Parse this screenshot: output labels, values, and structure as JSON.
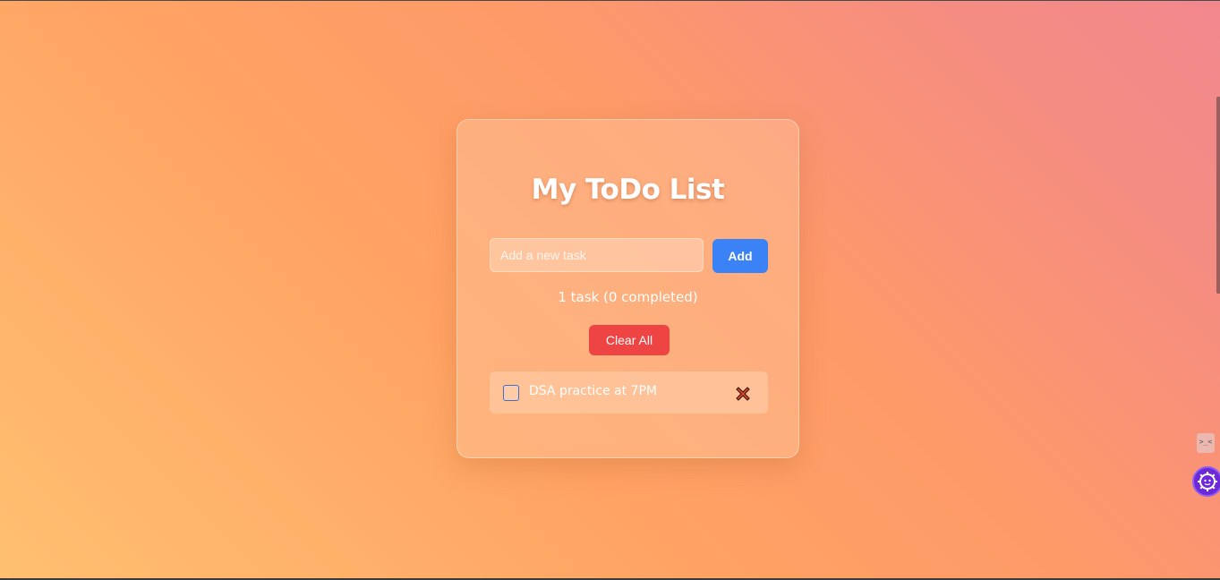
{
  "app": {
    "title": "My ToDo List"
  },
  "input": {
    "placeholder": "Add a new task",
    "value": ""
  },
  "buttons": {
    "add_label": "Add",
    "clear_label": "Clear All"
  },
  "counter": {
    "text": "1 task (0 completed)"
  },
  "tasks": [
    {
      "text": "DSA practice at 7PM",
      "completed": false
    }
  ],
  "icons": {
    "delete": "cross-mark-icon",
    "devtools": "code-icon",
    "assistant": "gear-face-icon"
  },
  "colors": {
    "add_button": "#3b82f6",
    "clear_button": "#ef4444",
    "delete_cross": "#e0442b"
  }
}
